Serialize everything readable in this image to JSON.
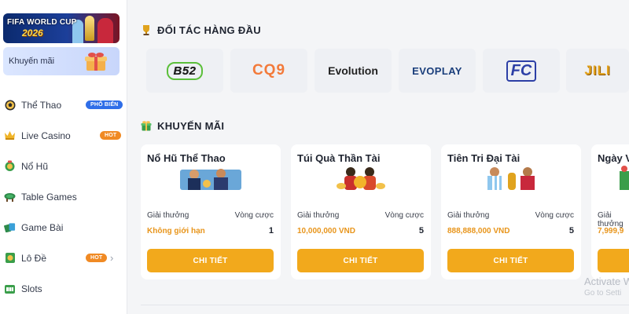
{
  "sidebar": {
    "banner": {
      "line1": "FIFA WORLD CUP",
      "line2": "2026"
    },
    "promo_label": "Khuyến mãi",
    "items": [
      {
        "label": "Thể Thao",
        "badge": "PHỔ BIẾN",
        "icon": "soccer-ball-icon"
      },
      {
        "label": "Live Casino",
        "badge": "HOT",
        "icon": "crown-icon"
      },
      {
        "label": "Nổ Hũ",
        "icon": "jackpot-icon"
      },
      {
        "label": "Table Games",
        "icon": "table-icon"
      },
      {
        "label": "Game Bài",
        "icon": "cards-icon"
      },
      {
        "label": "Lô Đề",
        "badge": "HOT",
        "icon": "lottery-icon",
        "chevron": "›"
      },
      {
        "label": "Slots",
        "icon": "slot-icon"
      }
    ]
  },
  "partners": {
    "title": "ĐỐI TÁC HÀNG ĐẦU",
    "items": [
      "B52",
      "CQ9",
      "Evolution",
      "EVOPLAY",
      "FC",
      "JILI"
    ]
  },
  "promotions": {
    "title": "KHUYẾN MÃI",
    "prize_label": "Giải thưởng",
    "wager_label": "Vòng cược",
    "button_label": "CHI TIẾT",
    "cards": [
      {
        "title": "Nổ Hũ Thể Thao",
        "prize": "Không giới hạn",
        "wager": "1"
      },
      {
        "title": "Túi Quà Thần Tài",
        "prize": "10,000,000 VND",
        "wager": "5"
      },
      {
        "title": "Tiên Tri Đại Tài",
        "prize": "888,888,000 VND",
        "wager": "5"
      },
      {
        "title": "Ngày V",
        "prize": "7,999,9",
        "wager": ""
      }
    ]
  },
  "watermark": {
    "line1": "Activate Wi",
    "line2": "Go to Setti"
  },
  "colors": {
    "accent": "#f2a91c",
    "badge_blue": "#2f6ee8",
    "badge_orange": "#f08a24",
    "prize_orange": "#e8951b"
  }
}
